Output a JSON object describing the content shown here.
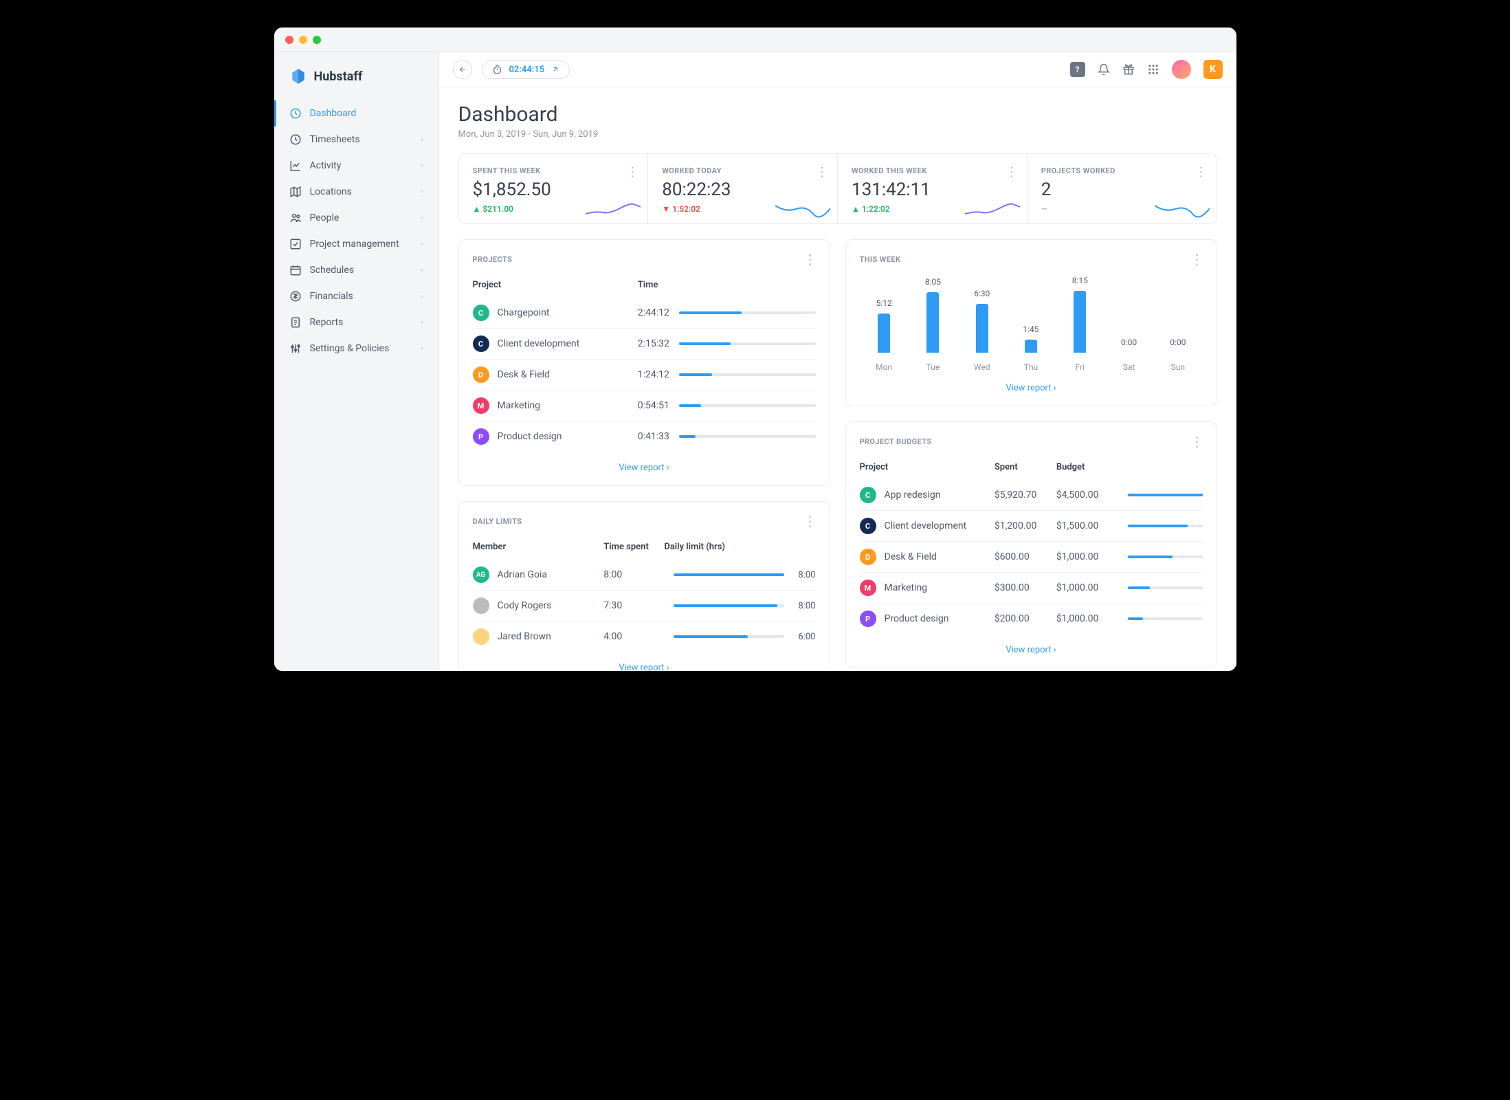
{
  "brand": "Hubstaff",
  "sidebar": {
    "items": [
      {
        "label": "Dashboard",
        "active": true,
        "expandable": false,
        "icon": "dashboard"
      },
      {
        "label": "Timesheets",
        "active": false,
        "expandable": true,
        "icon": "clock"
      },
      {
        "label": "Activity",
        "active": false,
        "expandable": true,
        "icon": "chart"
      },
      {
        "label": "Locations",
        "active": false,
        "expandable": true,
        "icon": "map"
      },
      {
        "label": "People",
        "active": false,
        "expandable": true,
        "icon": "people"
      },
      {
        "label": "Project management",
        "active": false,
        "expandable": true,
        "icon": "check"
      },
      {
        "label": "Schedules",
        "active": false,
        "expandable": true,
        "icon": "calendar"
      },
      {
        "label": "Financials",
        "active": false,
        "expandable": true,
        "icon": "dollar"
      },
      {
        "label": "Reports",
        "active": false,
        "expandable": true,
        "icon": "report"
      },
      {
        "label": "Settings & Policies",
        "active": false,
        "expandable": true,
        "icon": "settings"
      }
    ]
  },
  "topbar": {
    "timer": "02:44:15",
    "user_initial": "K"
  },
  "page": {
    "title": "Dashboard",
    "date_range": "Mon, Jun 3, 2019 - Sun, Jun 9, 2019"
  },
  "stats": [
    {
      "label": "SPENT THIS WEEK",
      "value": "$1,852.50",
      "delta": "$211.00",
      "dir": "up",
      "spark": "purple"
    },
    {
      "label": "WORKED TODAY",
      "value": "80:22:23",
      "delta": "1:52:02",
      "dir": "down",
      "spark": "blue"
    },
    {
      "label": "WORKED THIS WEEK",
      "value": "131:42:11",
      "delta": "1:22:02",
      "dir": "up",
      "spark": "purple"
    },
    {
      "label": "PROJECTS WORKED",
      "value": "2",
      "delta": "—",
      "dir": "neutral",
      "spark": "blue"
    }
  ],
  "projects_panel": {
    "title": "PROJECTS",
    "headers": {
      "project": "Project",
      "time": "Time"
    },
    "rows": [
      {
        "initial": "C",
        "color": "#1db98a",
        "name": "Chargepoint",
        "time": "2:44:12",
        "pct": 46
      },
      {
        "initial": "C",
        "color": "#122a54",
        "name": "Client development",
        "time": "2:15:32",
        "pct": 38
      },
      {
        "initial": "D",
        "color": "#ff9a1f",
        "name": "Desk & Field",
        "time": "1:24:12",
        "pct": 24
      },
      {
        "initial": "M",
        "color": "#ef3d6a",
        "name": "Marketing",
        "time": "0:54:51",
        "pct": 16
      },
      {
        "initial": "P",
        "color": "#8b4bff",
        "name": "Product design",
        "time": "0:41:33",
        "pct": 12
      }
    ],
    "view_report": "View report"
  },
  "this_week_panel": {
    "title": "THIS WEEK",
    "view_report": "View report"
  },
  "chart_data": {
    "type": "bar",
    "categories": [
      "Mon",
      "Tue",
      "Wed",
      "Thu",
      "Fri",
      "Sat",
      "Sun"
    ],
    "values_label": [
      "5:12",
      "8:05",
      "6:30",
      "1:45",
      "8:15",
      "0:00",
      "0:00"
    ],
    "values_minutes": [
      312,
      485,
      390,
      105,
      495,
      0,
      0
    ],
    "title": "THIS WEEK",
    "xlabel": "",
    "ylabel": "",
    "ylim": [
      0,
      500
    ]
  },
  "daily_limits_panel": {
    "title": "DAILY LIMITS",
    "headers": {
      "member": "Member",
      "time_spent": "Time spent",
      "daily_limit": "Daily limit (hrs)"
    },
    "rows": [
      {
        "initials": "AG",
        "color": "#1db98a",
        "name": "Adrian Goia",
        "spent": "8:00",
        "limit": "8:00",
        "pct": 100,
        "avatar": null
      },
      {
        "initials": "",
        "color": "#bbb",
        "name": "Cody Rogers",
        "spent": "7:30",
        "limit": "8:00",
        "pct": 94,
        "avatar": "gray"
      },
      {
        "initials": "",
        "color": "#ffd37a",
        "name": "Jared Brown",
        "spent": "4:00",
        "limit": "6:00",
        "pct": 67,
        "avatar": "yellow"
      }
    ],
    "view_report": "View report"
  },
  "budgets_panel": {
    "title": "PROJECT BUDGETS",
    "headers": {
      "project": "Project",
      "spent": "Spent",
      "budget": "Budget"
    },
    "rows": [
      {
        "initial": "C",
        "color": "#1db98a",
        "name": "App redesign",
        "spent": "$5,920.70",
        "budget": "$4,500.00",
        "pct": 100
      },
      {
        "initial": "C",
        "color": "#122a54",
        "name": "Client development",
        "spent": "$1,200.00",
        "budget": "$1,500.00",
        "pct": 80
      },
      {
        "initial": "D",
        "color": "#ff9a1f",
        "name": "Desk & Field",
        "spent": "$600.00",
        "budget": "$1,000.00",
        "pct": 60
      },
      {
        "initial": "M",
        "color": "#ef3d6a",
        "name": "Marketing",
        "spent": "$300.00",
        "budget": "$1,000.00",
        "pct": 30
      },
      {
        "initial": "P",
        "color": "#8b4bff",
        "name": "Product design",
        "spent": "$200.00",
        "budget": "$1,000.00",
        "pct": 20
      }
    ],
    "view_report": "View report"
  }
}
